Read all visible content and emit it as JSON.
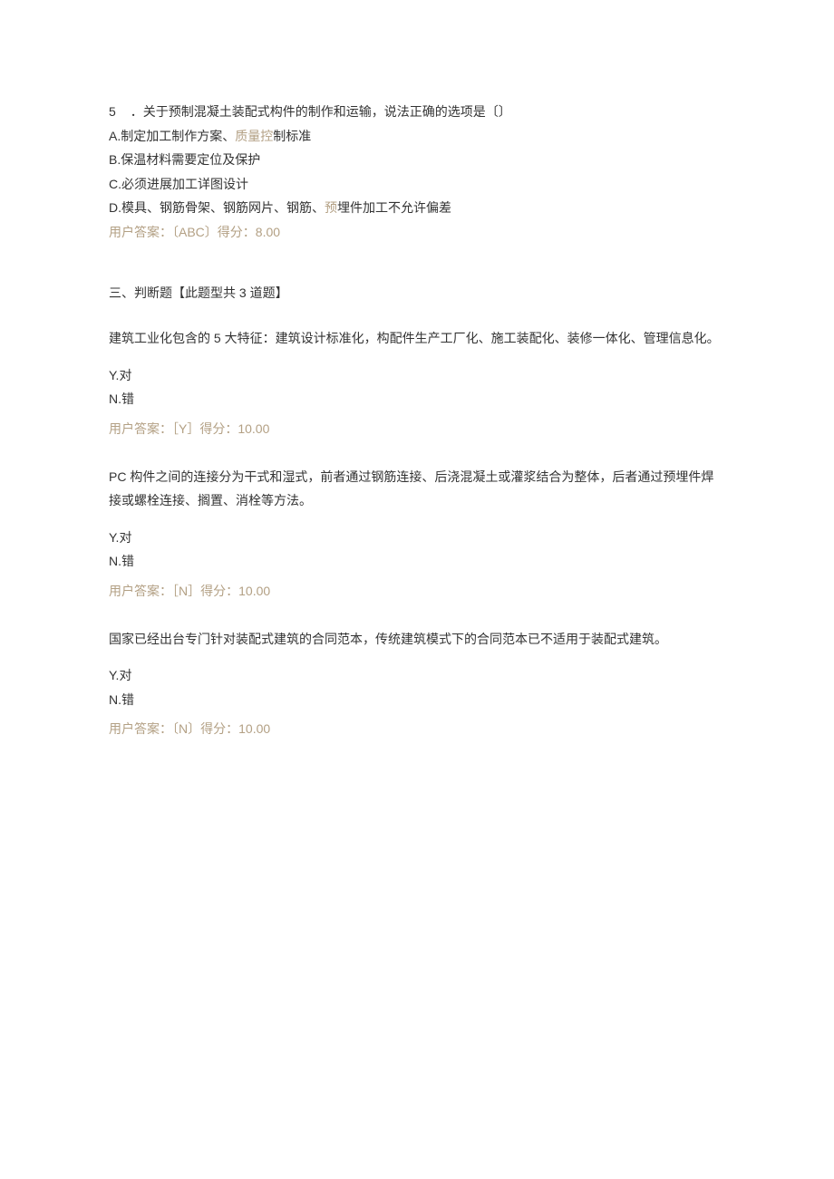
{
  "q5": {
    "number": "5",
    "stem_prefix": "．关于预制混凝土装配式构件的制作和",
    "stem_bold": "运输",
    "stem_suffix": "，说法正确的选项是",
    "paren": "〔〕",
    "options": {
      "A": {
        "letter": "A.",
        "text_prefix": "制定加工制作方案、",
        "text_grey": "质量控",
        "text_suffix": "制标准"
      },
      "B": {
        "letter": "B.",
        "text": "保温材料需要定位及保护"
      },
      "C": {
        "letter": "C.",
        "text": "必须进展加工详图设计"
      },
      "D": {
        "letter": "D.",
        "text_prefix": "模具、钢筋骨架、钢筋网片、钢筋、",
        "text_grey": "预",
        "text_suffix": "埋件加工不允许偏差"
      }
    },
    "answer": {
      "label": "用户答案：",
      "value": "〔ABC〕",
      "score_label": "得分：",
      "score": "8.00"
    }
  },
  "section3": {
    "title": "三、判断题【此题型共 3 道题】"
  },
  "j1": {
    "stem": "建筑工业化包含的 5 大特征：建筑设计标准化，构配件生产工厂化、施工装配化、装修一体化、管理信息化。",
    "Y": {
      "letter": "Y.",
      "text": "对"
    },
    "N": {
      "letter": "N.",
      "text": "错"
    },
    "answer": {
      "label": "用户答案：",
      "value": "［Y］",
      "score_label": "得分：",
      "score": "10.00"
    }
  },
  "j2": {
    "stem": "PC 构件之间的连接分为干式和湿式，前者通过钢筋连接、后浇混凝土或灌浆结合为整体，后者通过预埋件焊接或螺栓连接、搁置、消栓等方法。",
    "Y": {
      "letter": "Y.",
      "text": "对"
    },
    "N": {
      "letter": "N.",
      "text": "错"
    },
    "answer": {
      "label": "用户答案：",
      "value": "［N］",
      "score_label": "得分：",
      "score": "10.00"
    }
  },
  "j3": {
    "stem": "国家已经出台专门针对装配式建筑的合同范本，传统建筑模式下的合同范本已不适用于装配式建筑。",
    "Y": {
      "letter": "Y.",
      "text": "对"
    },
    "N": {
      "letter": "N.",
      "text": "错"
    },
    "answer": {
      "label": "用户答案：",
      "value": "〔N〕",
      "score_label": "得分：",
      "score": "10.00"
    }
  }
}
